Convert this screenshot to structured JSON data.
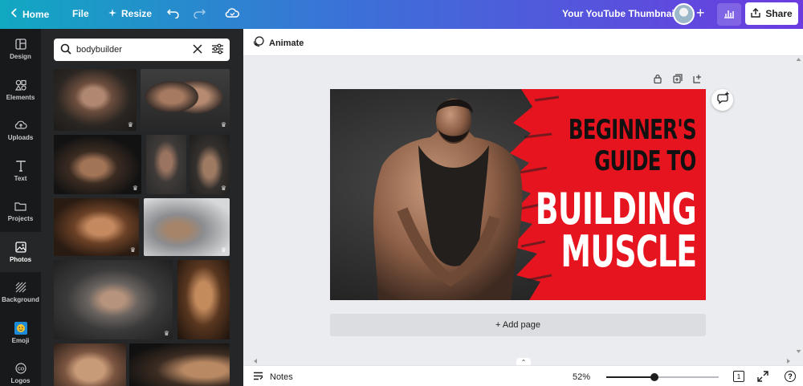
{
  "topbar": {
    "home_label": "Home",
    "file_label": "File",
    "resize_label": "Resize",
    "document_title": "Your YouTube Thumbnail",
    "share_label": "Share",
    "gradient_start": "#11a8c2",
    "gradient_end": "#6c3be0"
  },
  "rail": {
    "items": [
      {
        "label": "Design",
        "icon": "layout-icon"
      },
      {
        "label": "Elements",
        "icon": "shapes-icon"
      },
      {
        "label": "Uploads",
        "icon": "cloud-upload-icon"
      },
      {
        "label": "Text",
        "icon": "text-icon"
      },
      {
        "label": "Projects",
        "icon": "folder-icon"
      },
      {
        "label": "Photos",
        "icon": "image-icon"
      },
      {
        "label": "Background",
        "icon": "hatch-icon"
      },
      {
        "label": "Emoji",
        "icon": "emoji-icon"
      },
      {
        "label": "Logos",
        "icon": "logo-icon"
      }
    ],
    "active": "Photos"
  },
  "panel": {
    "search_value": "bodybuilder"
  },
  "editor": {
    "animate_label": "Animate",
    "add_page_label": "+ Add page"
  },
  "design": {
    "line1": "BEGINNER'S",
    "line2": "GUIDE TO",
    "line3": "BUILDING",
    "line4": "MUSCLE",
    "accent_color": "#e5141f"
  },
  "bottombar": {
    "notes_label": "Notes",
    "zoom": "52%",
    "zoom_fraction": 0.52,
    "page_count": "1"
  }
}
